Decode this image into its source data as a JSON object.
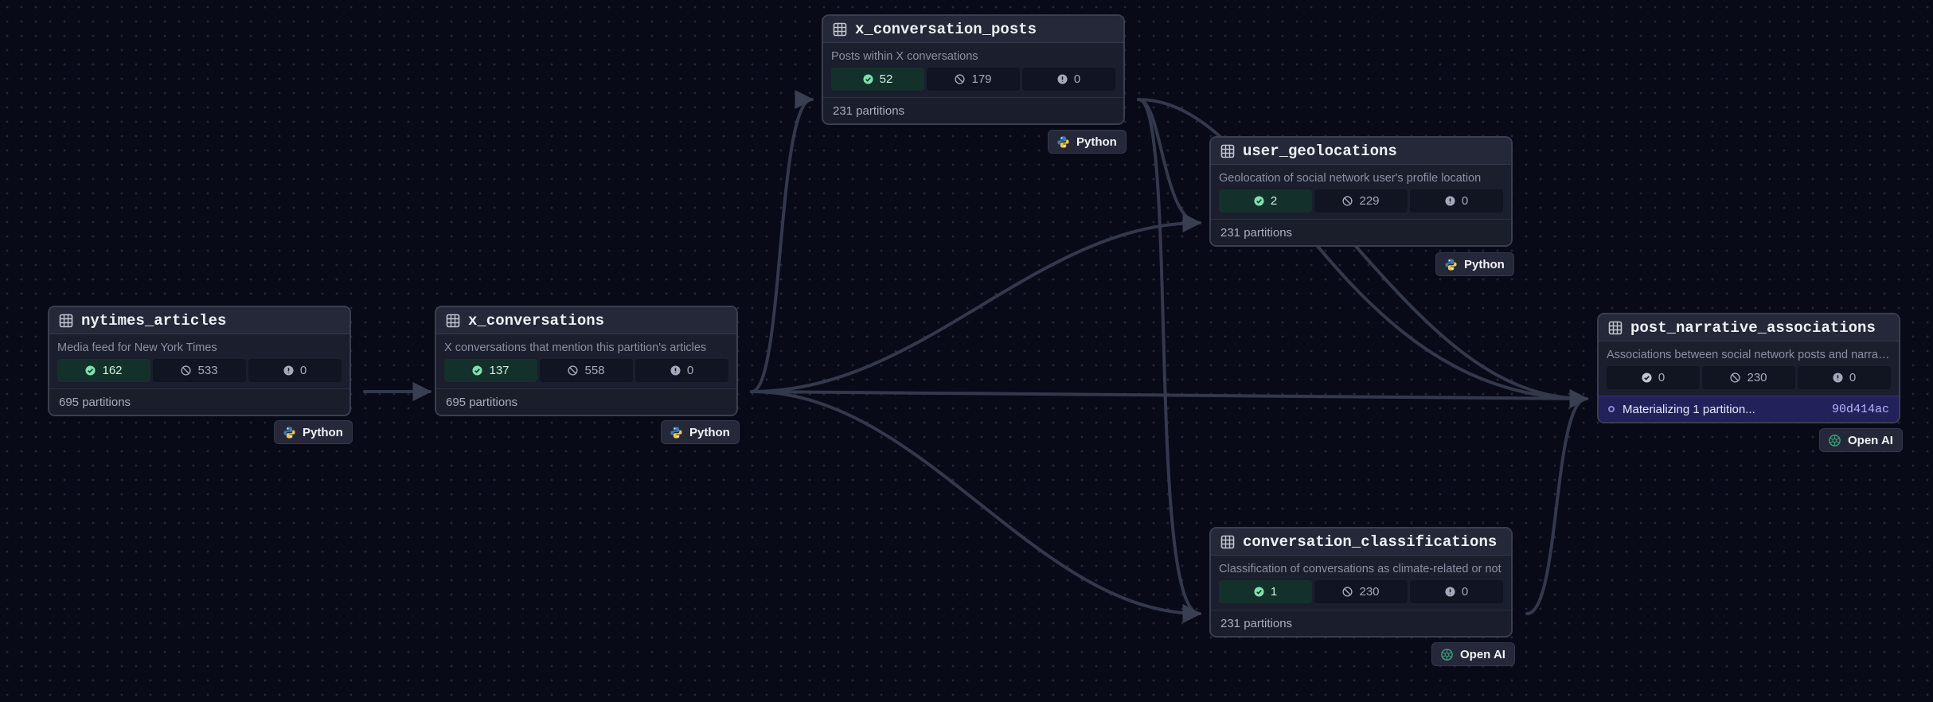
{
  "assets": {
    "nytimes_articles": {
      "name": "nytimes_articles",
      "description": "Media feed for New York Times",
      "stats": {
        "success": "162",
        "missing": "533",
        "failed": "0"
      },
      "footer": "695 partitions",
      "kind": {
        "label": "Python",
        "icon": "python-icon"
      }
    },
    "x_conversations": {
      "name": "x_conversations",
      "description": "X conversations that mention this partition's articles",
      "stats": {
        "success": "137",
        "missing": "558",
        "failed": "0"
      },
      "footer": "695 partitions",
      "kind": {
        "label": "Python",
        "icon": "python-icon"
      }
    },
    "x_conversation_posts": {
      "name": "x_conversation_posts",
      "description": "Posts within X conversations",
      "stats": {
        "success": "52",
        "missing": "179",
        "failed": "0"
      },
      "footer": "231 partitions",
      "kind": {
        "label": "Python",
        "icon": "python-icon"
      }
    },
    "user_geolocations": {
      "name": "user_geolocations",
      "description": "Geolocation of social network user's profile location",
      "stats": {
        "success": "2",
        "missing": "229",
        "failed": "0"
      },
      "footer": "231 partitions",
      "kind": {
        "label": "Python",
        "icon": "python-icon"
      }
    },
    "conversation_classifications": {
      "name": "conversation_classifications",
      "description": "Classification of conversations as climate-related or not",
      "stats": {
        "success": "1",
        "missing": "230",
        "failed": "0"
      },
      "footer": "231 partitions",
      "kind": {
        "label": "Open AI",
        "icon": "openai-icon"
      }
    },
    "post_narrative_associations": {
      "name": "post_narrative_associations",
      "description": "Associations between social network posts and narratives",
      "stats": {
        "success": "0",
        "missing": "230",
        "failed": "0"
      },
      "run": {
        "label": "Materializing 1 partition...",
        "run_id": "90d414ac"
      },
      "kind": {
        "label": "Open AI",
        "icon": "openai-icon"
      }
    }
  },
  "colors": {
    "background": "#080a17",
    "card": "#1b1e2c",
    "card_border": "#3a3e4f",
    "success_chip": "#14302a",
    "running_footer": "#22215a",
    "edge": "#34384b"
  }
}
